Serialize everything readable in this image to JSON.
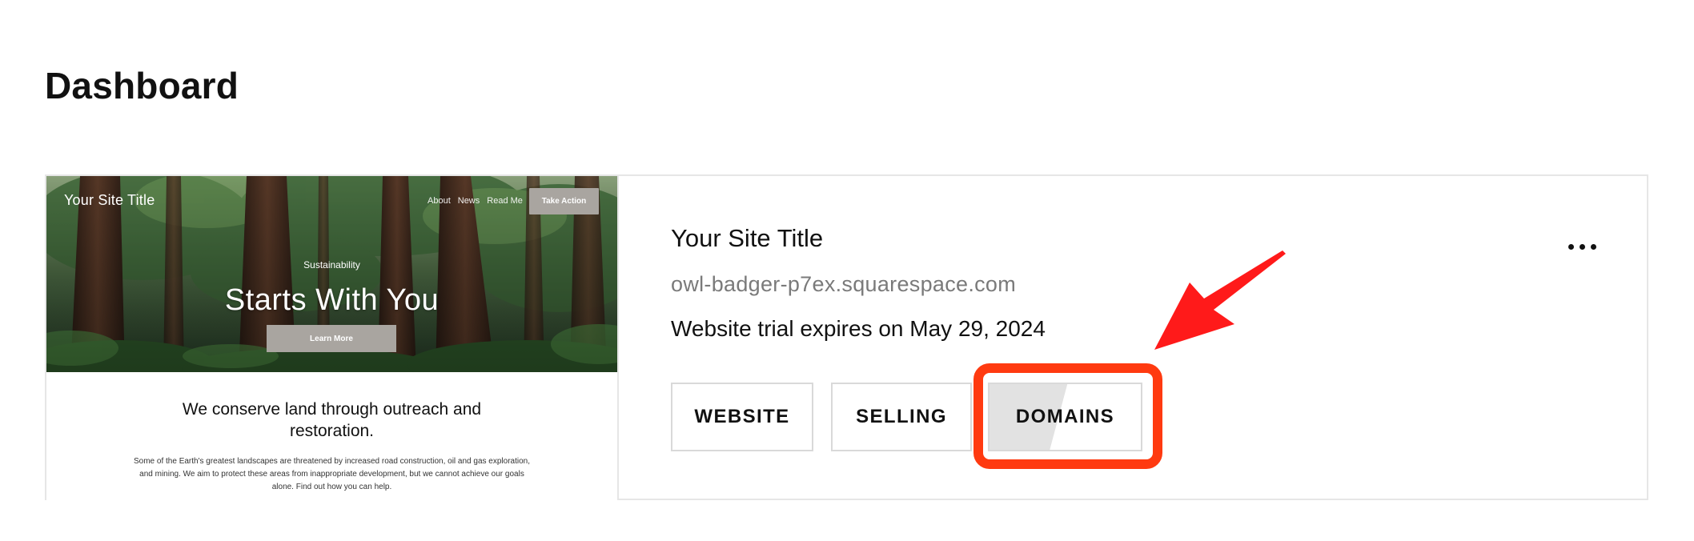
{
  "page_title": "Dashboard",
  "thumbnail": {
    "site_title": "Your Site Title",
    "nav": [
      "About",
      "News",
      "Read Me"
    ],
    "cta_label": "Take Action",
    "hero_kicker": "Sustainability",
    "hero_title": "Starts With You",
    "hero_button": "Learn More",
    "heading": "We conserve land through outreach and restoration.",
    "paragraph": "Some of the Earth's greatest landscapes are threatened by increased road construction, oil and gas exploration, and mining. We aim to protect these areas from inappropriate development, but we cannot achieve our goals alone. Find out how you can help."
  },
  "site": {
    "title": "Your Site Title",
    "domain": "owl-badger-p7ex.squarespace.com",
    "trial": "Website trial expires on May 29, 2024"
  },
  "actions": {
    "website": "WEBSITE",
    "selling": "SELLING",
    "domains": "DOMAINS"
  },
  "colors": {
    "annotation": "#ff3a10",
    "arrow": "#ff1a1a",
    "button_border": "#d9d9d9"
  },
  "icons": {
    "more": "more-horizontal-icon"
  }
}
